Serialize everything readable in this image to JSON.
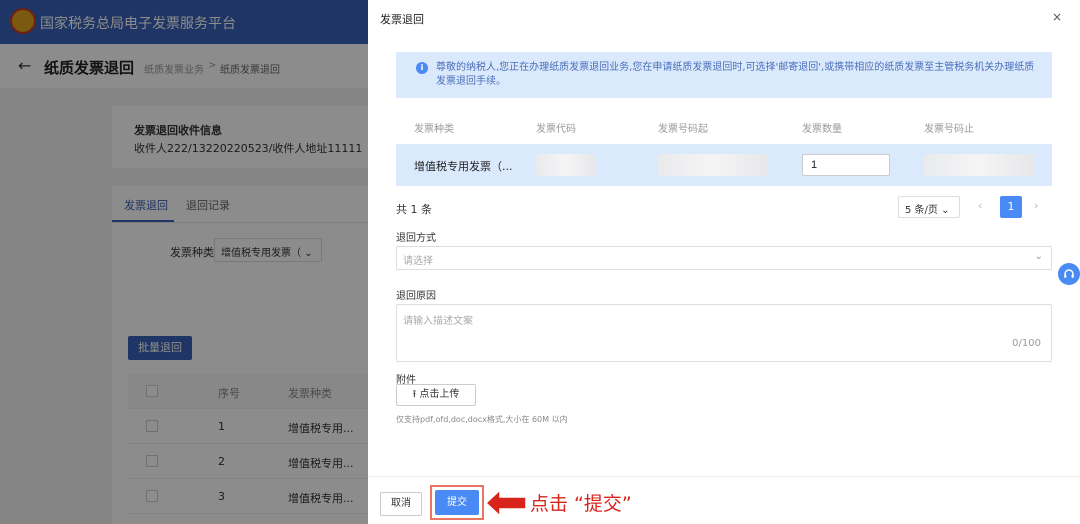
{
  "background": {
    "platform_title": "国家税务总局电子发票服务平台",
    "page_title": "纸质发票退回",
    "breadcrumb": [
      "纸质发票业务",
      "纸质发票退回"
    ],
    "breadcrumb_sep": ">",
    "receiver": {
      "title": "发票退回收件信息",
      "info": "收件人222/13220220523/收件人地址11111"
    },
    "tabs": [
      "发票退回",
      "退回记录"
    ],
    "filter": {
      "label": "发票种类",
      "value": "增值税专用发票（"
    },
    "batch_button": "批量退回",
    "table": {
      "headers": [
        "序号",
        "发票种类"
      ],
      "rows": [
        {
          "no": "1",
          "type": "增值税专用..."
        },
        {
          "no": "2",
          "type": "增值税专用..."
        },
        {
          "no": "3",
          "type": "增值税专用..."
        }
      ]
    }
  },
  "drawer": {
    "title": "发票退回",
    "close": "×",
    "notice": "尊敬的纳税人,您正在办理纸质发票退回业务,您在申请纸质发票退回时,可选择'邮寄退回',或携带相应的纸质发票至主管税务机关办理纸质发票退回手续。",
    "table": {
      "headers": [
        "发票种类",
        "发票代码",
        "发票号码起",
        "发票数量",
        "发票号码止"
      ],
      "row": {
        "type": "增值税专用发票（...",
        "quantity": "1"
      }
    },
    "total": "共 1 条",
    "page_size": "5 条/页",
    "current_page": "1",
    "prev": "‹",
    "next": "›",
    "method": {
      "label": "退回方式",
      "placeholder": "请选择"
    },
    "reason": {
      "label": "退回原因",
      "placeholder": "请输入描述文案",
      "counter": "0/100"
    },
    "attachment": {
      "label": "附件",
      "upload_button": "点击上传",
      "hint": "仅支持pdf,ofd,doc,docx格式,大小在 60M 以内"
    },
    "cancel_button": "取消",
    "submit_button": "提交"
  },
  "annotation": {
    "text": "点击 “提交”"
  },
  "icons": {
    "back": "arrow-left-icon",
    "info": "info-icon",
    "help": "headset-icon",
    "upload": "upload-icon",
    "dropdown": "chevron-down-icon"
  },
  "colors": {
    "brand": "#3a62b8",
    "primary": "#4a8af4",
    "notice_bg": "#dbe9fd",
    "highlight": "#e87463",
    "annotation": "#d8241c"
  }
}
